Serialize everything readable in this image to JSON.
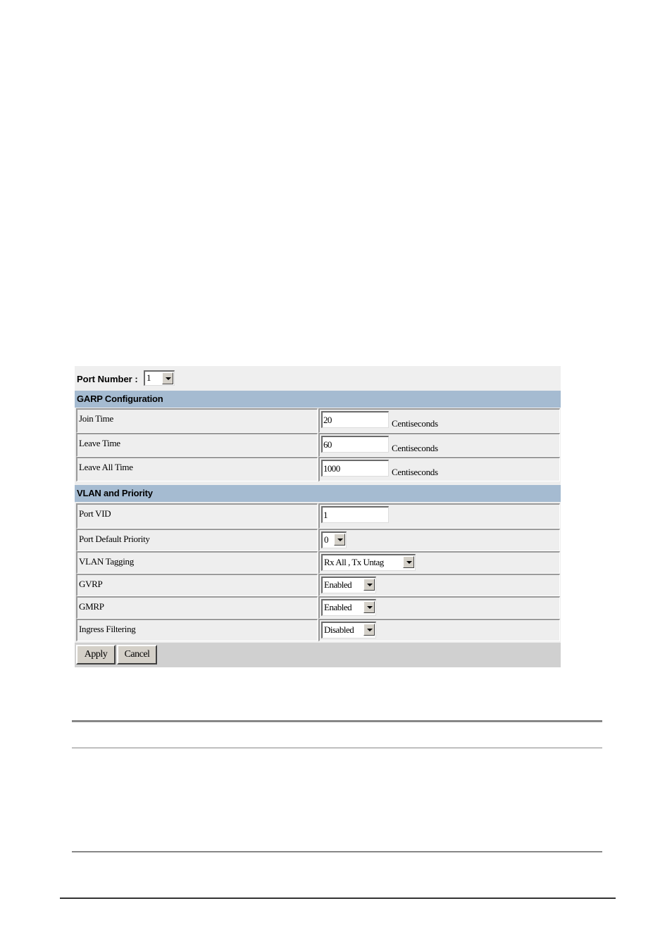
{
  "form": {
    "port_number_label": "Port Number :",
    "port_number_value": "1",
    "sections": {
      "garp": {
        "title": "GARP Configuration",
        "rows": [
          {
            "label": "Join Time",
            "value": "20",
            "unit": "Centiseconds"
          },
          {
            "label": "Leave Time",
            "value": "60",
            "unit": "Centiseconds"
          },
          {
            "label": "Leave All Time",
            "value": "1000",
            "unit": "Centiseconds"
          }
        ]
      },
      "vlan": {
        "title": "VLAN and Priority",
        "rows": [
          {
            "label": "Port VID",
            "type": "text",
            "value": "1"
          },
          {
            "label": "Port Default Priority",
            "type": "select",
            "value": "0"
          },
          {
            "label": "VLAN Tagging",
            "type": "select",
            "value": "Rx All , Tx Untag"
          },
          {
            "label": "GVRP",
            "type": "select",
            "value": "Enabled"
          },
          {
            "label": "GMRP",
            "type": "select",
            "value": "Enabled"
          },
          {
            "label": "Ingress Filtering",
            "type": "select",
            "value": "Disabled"
          }
        ]
      }
    },
    "buttons": {
      "apply": "Apply",
      "cancel": "Cancel"
    }
  },
  "colors": {
    "section_header": "#a5bbd1",
    "panel_bg": "#eeeeee",
    "footer_bg": "#d0d0d0",
    "rule_gray": "#878787",
    "rule_dark": "#333333"
  }
}
